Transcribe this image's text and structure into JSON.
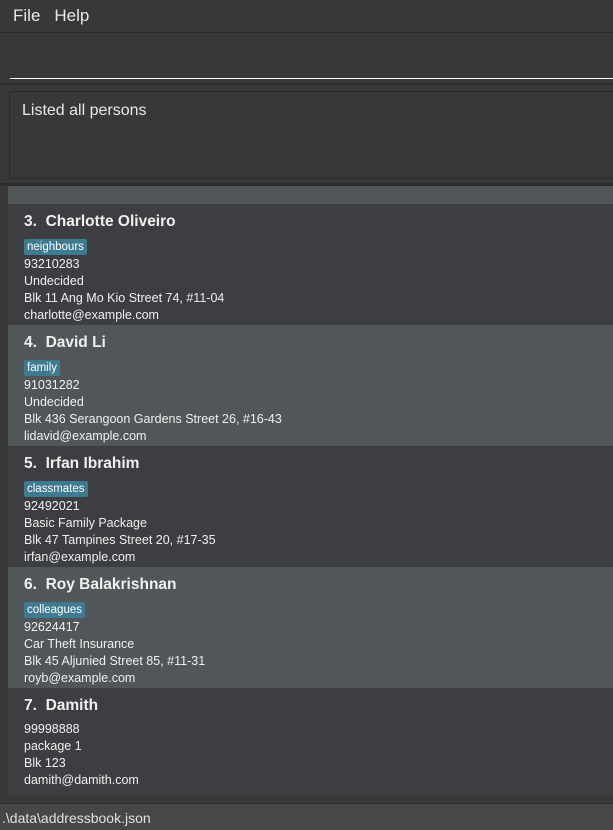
{
  "menu": {
    "file": "File",
    "help": "Help"
  },
  "command": {
    "value": ""
  },
  "result": {
    "text": "Listed all persons"
  },
  "persons": [
    {
      "index": "3.",
      "name": "Charlotte Oliveiro",
      "tag": "neighbours",
      "phone": "93210283",
      "package": "Undecided",
      "address": "Blk 11 Ang Mo Kio Street 74, #11-04",
      "email": "charlotte@example.com"
    },
    {
      "index": "4.",
      "name": "David Li",
      "tag": "family",
      "phone": "91031282",
      "package": "Undecided",
      "address": "Blk 436 Serangoon Gardens Street 26, #16-43",
      "email": "lidavid@example.com"
    },
    {
      "index": "5.",
      "name": "Irfan Ibrahim",
      "tag": "classmates",
      "phone": "92492021",
      "package": "Basic Family Package",
      "address": "Blk 47 Tampines Street 20, #17-35",
      "email": "irfan@example.com"
    },
    {
      "index": "6.",
      "name": "Roy Balakrishnan",
      "tag": "colleagues",
      "phone": "92624417",
      "package": "Car Theft Insurance",
      "address": "Blk 45 Aljunied Street 85, #11-31",
      "email": "royb@example.com"
    },
    {
      "index": "7.",
      "name": "Damith",
      "phone": "99998888",
      "package": "package 1",
      "address": "Blk 123",
      "email": "damith@damith.com"
    }
  ],
  "status": {
    "path": ".\\data\\addressbook.json"
  }
}
